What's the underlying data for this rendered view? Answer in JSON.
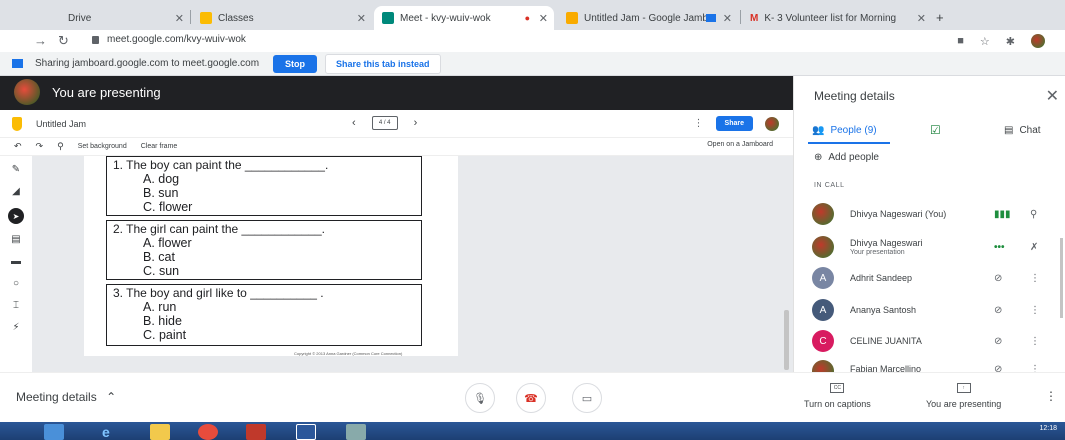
{
  "browser": {
    "tabs": [
      {
        "label": "Drive",
        "active": false
      },
      {
        "label": "Classes",
        "active": false
      },
      {
        "label": "Meet - kvy-wuiv-wok",
        "active": true
      },
      {
        "label": "Untitled Jam - Google Jamb",
        "active": false
      },
      {
        "label": "K- 3 Volunteer list for Morning",
        "active": false
      }
    ],
    "url": "meet.google.com/kvy-wuiv-wok"
  },
  "share_bar": {
    "text": "Sharing jamboard.google.com to meet.google.com",
    "stop_label": "Stop",
    "share_tab_label": "Share this tab instead"
  },
  "presenting": {
    "banner": "You are presenting"
  },
  "jamboard": {
    "title": "Untitled Jam",
    "frame_indicator": "4 / 4",
    "share_label": "Share",
    "set_background": "Set background",
    "clear_frame": "Clear frame",
    "open_on_jamboard": "Open on a Jamboard",
    "worksheet": {
      "questions": [
        {
          "text": "1. The boy can paint the ____________.",
          "options": [
            "A. dog",
            "B. sun",
            "C. flower"
          ]
        },
        {
          "text": "2. The girl can paint the ____________.",
          "options": [
            "A. flower",
            "B. cat",
            "C. sun"
          ]
        },
        {
          "text": "3. The boy and girl like to __________ .",
          "options": [
            "A. run",
            "B. hide",
            "C. paint"
          ]
        }
      ],
      "copyright": "Copyright © 2013 Anna Gardner (Common Core Connection)"
    }
  },
  "panel": {
    "title": "Meeting details",
    "tabs": {
      "people": "People (9)",
      "chat": "Chat"
    },
    "add_people": "Add people",
    "in_call_label": "IN CALL",
    "participants": [
      {
        "name": "Dhivya Nageswari (You)",
        "sub": "",
        "initial": "",
        "color": "",
        "photo": true
      },
      {
        "name": "Dhivya Nageswari",
        "sub": "Your presentation",
        "initial": "",
        "color": "",
        "photo": true
      },
      {
        "name": "Adhrit Sandeep",
        "sub": "",
        "initial": "A",
        "color": "#7986a3",
        "photo": false
      },
      {
        "name": "Ananya Santosh",
        "sub": "",
        "initial": "A",
        "color": "#455a7a",
        "photo": false
      },
      {
        "name": "CELINE JUANITA",
        "sub": "",
        "initial": "C",
        "color": "#d81b60",
        "photo": false
      },
      {
        "name": "Fabian Marcellino",
        "sub": "",
        "initial": "",
        "color": "",
        "photo": true
      }
    ]
  },
  "bottom_bar": {
    "meeting_details": "Meeting details",
    "captions_label": "Turn on captions",
    "presenting_label": "You are presenting"
  },
  "taskbar": {
    "clock": "12:18"
  }
}
